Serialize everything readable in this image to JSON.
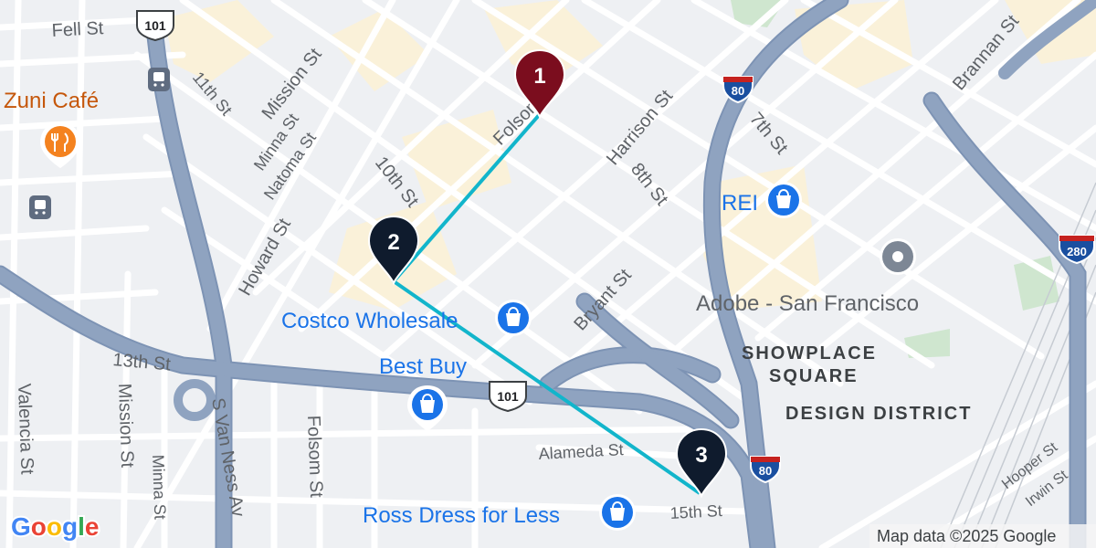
{
  "map": {
    "streets": {
      "fell": "Fell St",
      "mission_top": "Mission St",
      "eleventh": "11th St",
      "minna_top": "Minna St",
      "natoma": "Natoma St",
      "howard": "Howard St",
      "tenth": "10th St",
      "folsom_top": "Folsom St",
      "harrison": "Harrison St",
      "eighth": "8th St",
      "seventh": "7th St",
      "brannan": "Brannan St",
      "bryant": "Bryant St",
      "thirteenth": "13th St",
      "valencia": "Valencia St",
      "mission_bottom": "Mission St",
      "minna_bottom": "Minna St",
      "van_ness": "S Van Ness Av",
      "folsom_bottom": "Folsom St",
      "alameda": "Alameda St",
      "fifteenth": "15th St",
      "hooper": "Hooper St",
      "irwin": "Irwin St"
    },
    "highway_shields": {
      "us101_top": "101",
      "us101_mid": "101",
      "i80_top": "80",
      "i80_bottom": "80",
      "i280": "280"
    },
    "districts": {
      "showplace_line1": "SHOWPLACE",
      "showplace_line2": "SQUARE",
      "design_district": "DESIGN DISTRICT"
    },
    "pois": {
      "zuni": "Zuni Café",
      "rei": "REI",
      "adobe": "Adobe - San Francisco",
      "costco": "Costco Wholesale",
      "best_buy": "Best Buy",
      "ross": "Ross Dress for Less"
    },
    "markers": [
      {
        "label": "1",
        "color": "#7b0d1e"
      },
      {
        "label": "2",
        "color": "#0f1b2d"
      },
      {
        "label": "3",
        "color": "#0f1b2d"
      }
    ],
    "route_color": "#12b5cb",
    "colors": {
      "shopping_poi": "#1a73e8",
      "food_poi": "#f4821f",
      "highway": "#8fa3c0",
      "highway_edge": "#7d93b4",
      "commercial_area": "#faf1d9",
      "park": "#cfe6cf"
    },
    "attribution": "Map data ©2025 Google",
    "logo": "Google"
  }
}
